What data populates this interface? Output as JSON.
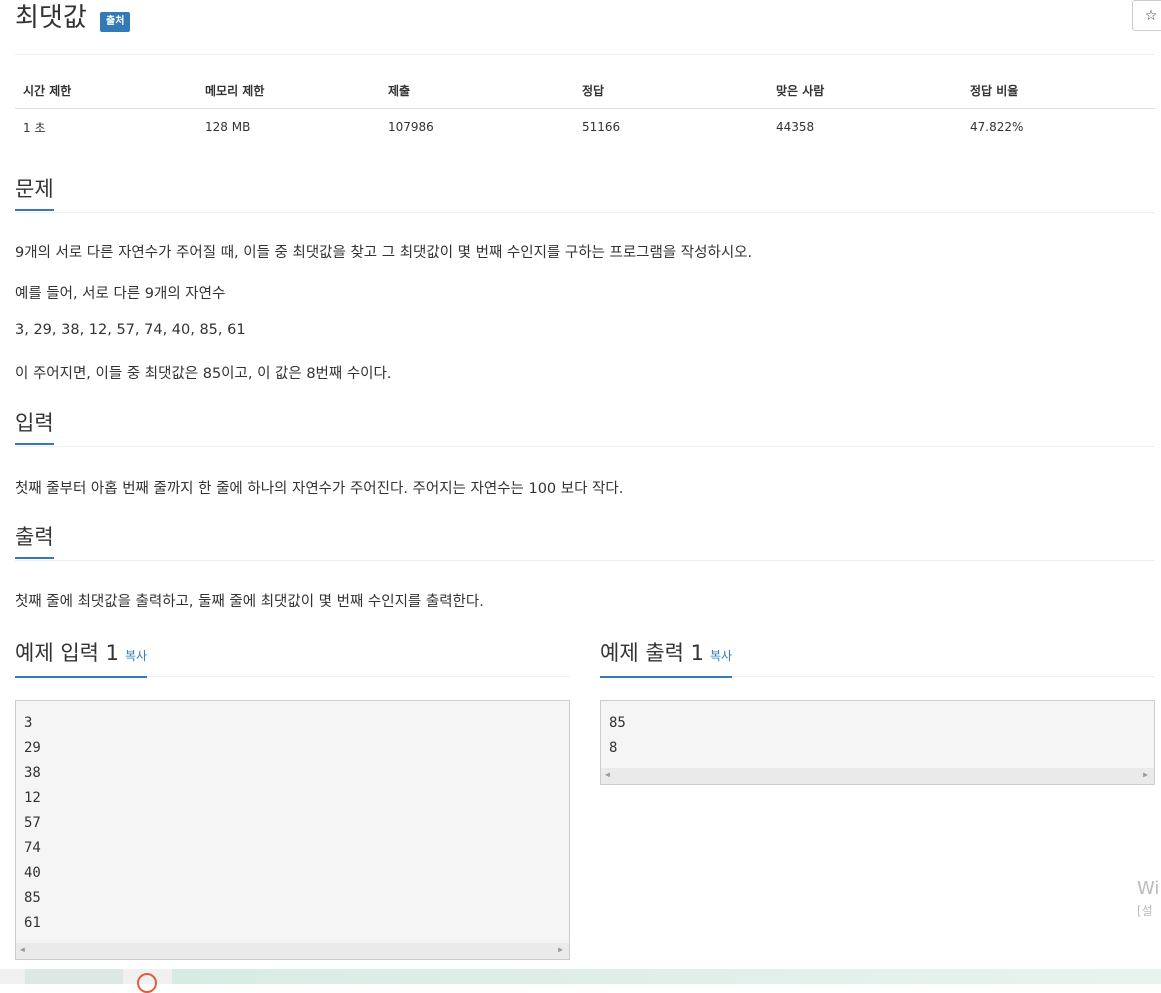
{
  "header": {
    "title": "최댓값",
    "badge": "출처",
    "star_glyph": "☆"
  },
  "info_table": {
    "headers": [
      "시간 제한",
      "메모리 제한",
      "제출",
      "정답",
      "맞은 사람",
      "정답 비율"
    ],
    "row": [
      "1 초",
      "128 MB",
      "107986",
      "51166",
      "44358",
      "47.822%"
    ]
  },
  "problem": {
    "heading": "문제",
    "paragraphs": [
      "9개의 서로 다른 자연수가 주어질 때, 이들 중 최댓값을 찾고 그 최댓값이 몇 번째 수인지를 구하는 프로그램을 작성하시오.",
      "예를 들어, 서로 다른 9개의 자연수",
      "3, 29, 38, 12, 57, 74, 40, 85, 61",
      "이 주어지면, 이들 중 최댓값은 85이고, 이 값은 8번째 수이다."
    ]
  },
  "input": {
    "heading": "입력",
    "text": "첫째 줄부터 아홉 번째 줄까지 한 줄에 하나의 자연수가 주어진다. 주어지는 자연수는 100 보다 작다."
  },
  "output": {
    "heading": "출력",
    "text": "첫째 줄에 최댓값을 출력하고, 둘째 줄에 최댓값이 몇 번째 수인지를 출력한다."
  },
  "sample_input": {
    "heading": "예제 입력 1",
    "copy_label": "복사",
    "lines": [
      "3",
      "29",
      "38",
      "12",
      "57",
      "74",
      "40",
      "85",
      "61"
    ]
  },
  "sample_output": {
    "heading": "예제 출력 1",
    "copy_label": "복사",
    "lines": [
      "85",
      "8"
    ]
  },
  "overlay": {
    "watermark_top": "Wi",
    "watermark_bottom": "[설"
  },
  "colors": {
    "accent": "#337ab7",
    "taskbar": "#dde8e4"
  }
}
